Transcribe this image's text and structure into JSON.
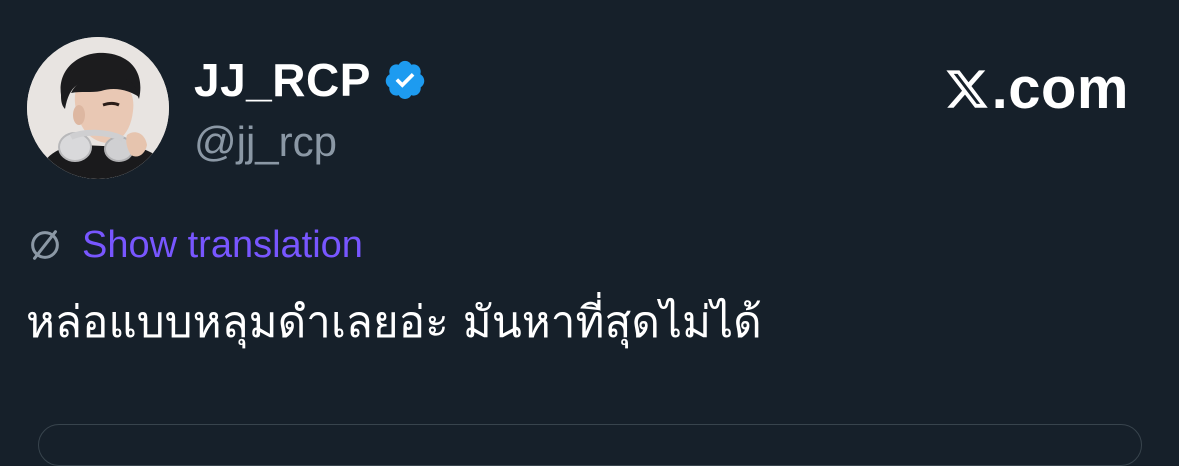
{
  "tweet": {
    "author": {
      "display_name": "JJ_RCP",
      "handle": "@jj_rcp",
      "verified_icon": "verified-badge-icon",
      "verified_color": "#1d9bf0",
      "avatar": "profile-photo"
    },
    "brand": {
      "icon": "x-logo-icon",
      "label": ".com"
    },
    "translate": {
      "icon": "globe-translate-icon",
      "label": "Show translation",
      "color": "#7856ff"
    },
    "text": "หล่อแบบหลุมดำเลยอ่ะ มันหาที่สุดไม่ได้"
  },
  "colors": {
    "background": "#16202a",
    "secondary_text": "#8b98a5",
    "primary_text": "#ffffff"
  }
}
